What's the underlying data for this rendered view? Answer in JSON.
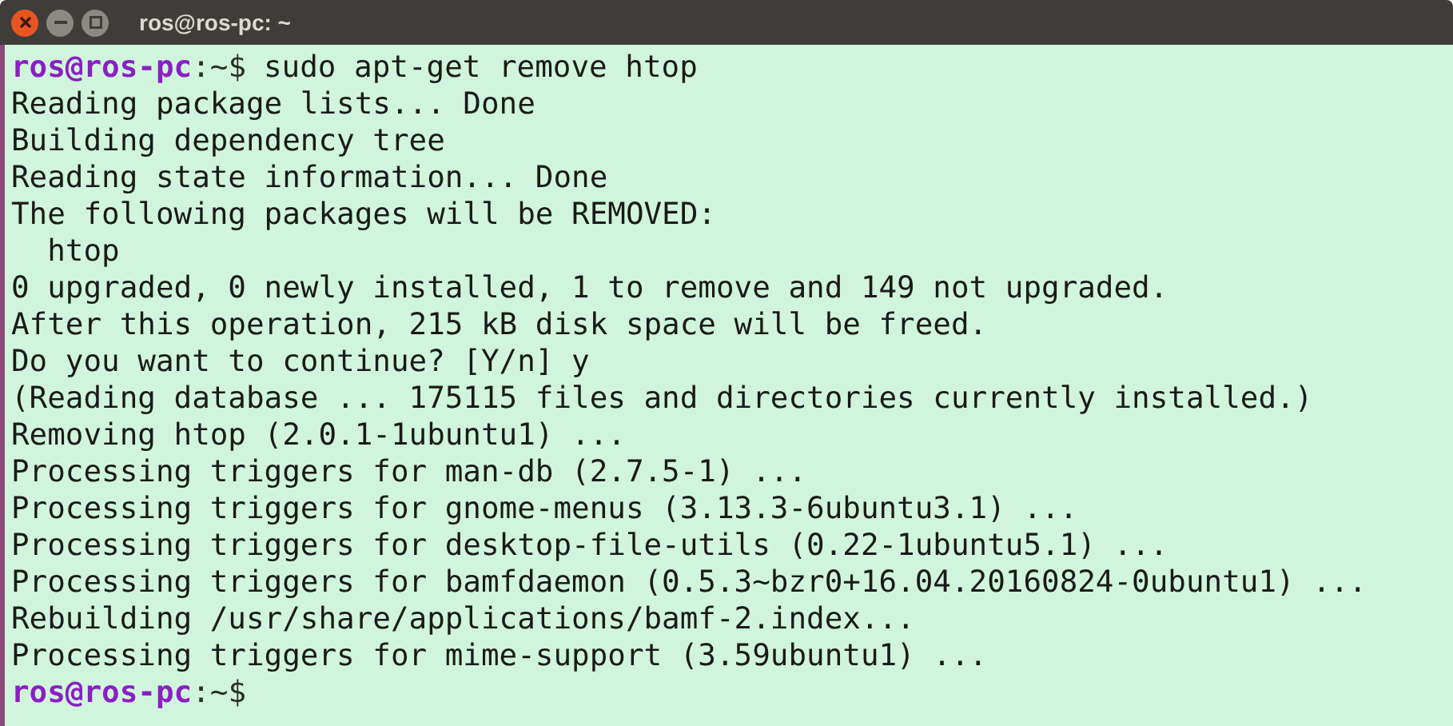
{
  "window": {
    "title": "ros@ros-pc: ~"
  },
  "terminal": {
    "lines": [
      {
        "kind": "prompt",
        "user_host": "ros@ros-pc",
        "path": ":~$",
        "command": "sudo apt-get remove htop"
      },
      {
        "kind": "output",
        "text": "Reading package lists... Done"
      },
      {
        "kind": "output",
        "text": "Building dependency tree"
      },
      {
        "kind": "output",
        "text": "Reading state information... Done"
      },
      {
        "kind": "output",
        "text": "The following packages will be REMOVED:"
      },
      {
        "kind": "output",
        "text": "  htop"
      },
      {
        "kind": "output",
        "text": "0 upgraded, 0 newly installed, 1 to remove and 149 not upgraded."
      },
      {
        "kind": "output",
        "text": "After this operation, 215 kB disk space will be freed."
      },
      {
        "kind": "output",
        "text": "Do you want to continue? [Y/n] y"
      },
      {
        "kind": "output",
        "text": "(Reading database ... 175115 files and directories currently installed.)"
      },
      {
        "kind": "output",
        "text": "Removing htop (2.0.1-1ubuntu1) ..."
      },
      {
        "kind": "output",
        "text": "Processing triggers for man-db (2.7.5-1) ..."
      },
      {
        "kind": "output",
        "text": "Processing triggers for gnome-menus (3.13.3-6ubuntu3.1) ..."
      },
      {
        "kind": "output",
        "text": "Processing triggers for desktop-file-utils (0.22-1ubuntu5.1) ..."
      },
      {
        "kind": "output",
        "text": "Processing triggers for bamfdaemon (0.5.3~bzr0+16.04.20160824-0ubuntu1) ..."
      },
      {
        "kind": "output",
        "text": "Rebuilding /usr/share/applications/bamf-2.index..."
      },
      {
        "kind": "output",
        "text": "Processing triggers for mime-support (3.59ubuntu1) ..."
      },
      {
        "kind": "prompt",
        "user_host": "ros@ros-pc",
        "path": ":~$"
      }
    ]
  }
}
